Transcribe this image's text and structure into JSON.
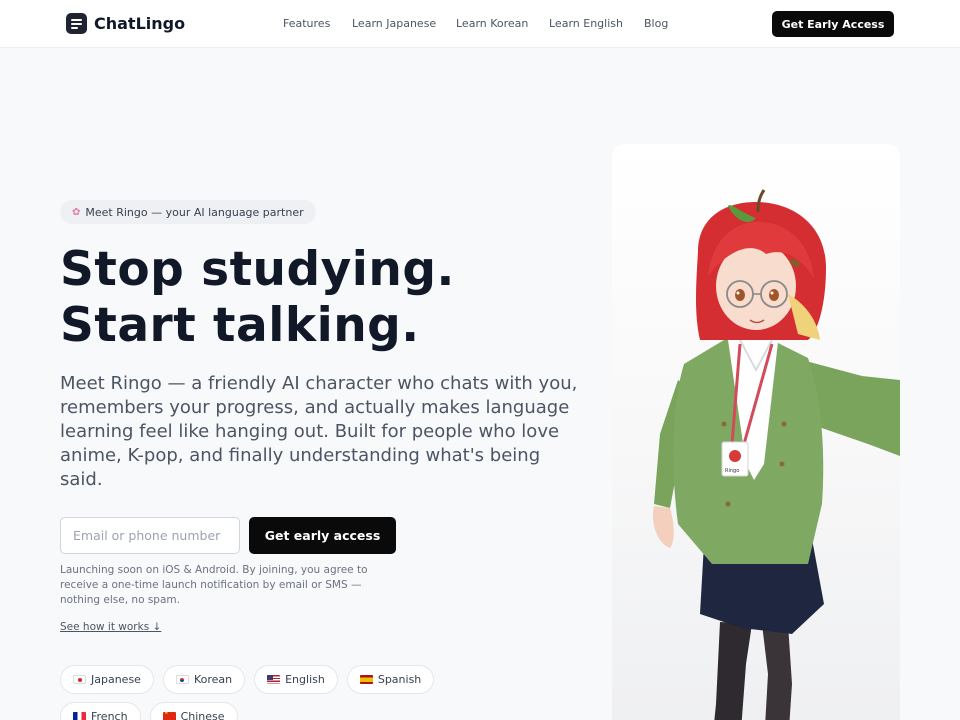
{
  "nav": {
    "brand": "ChatLingo",
    "links": [
      "Features",
      "Learn Japanese",
      "Learn Korean",
      "Learn English",
      "Blog"
    ],
    "cta": "Get Early Access"
  },
  "hero": {
    "badge": "Meet Ringo — your AI language partner",
    "badge_icon": "sakura-icon",
    "headline_line1": "Stop studying.",
    "headline_line2": "Start talking.",
    "subtitle": "Meet Ringo — a friendly AI character who chats with you, remembers your progress, and actually makes language learning feel like hanging out. Built for people who love anime, K-pop, and finally understanding what's being said.",
    "input_placeholder": "Email or phone number",
    "submit_label": "Get early access",
    "disclaimer": "Launching soon on iOS & Android. By joining, you agree to receive a one-time launch notification by email or SMS — nothing else, no spam.",
    "how_link": "See how it works ↓"
  },
  "languages": [
    {
      "flag": "jp",
      "label": "Japanese"
    },
    {
      "flag": "kr",
      "label": "Korean"
    },
    {
      "flag": "us",
      "label": "English"
    },
    {
      "flag": "es",
      "label": "Spanish"
    },
    {
      "flag": "fr",
      "label": "French"
    },
    {
      "flag": "cn",
      "label": "Chinese"
    }
  ],
  "image": {
    "badge_text": "Ringo"
  },
  "colors": {
    "primary_button": "#0a0a0a",
    "page_background": "#f8f9fb",
    "headline": "#111827",
    "body_text": "#4b5563"
  }
}
